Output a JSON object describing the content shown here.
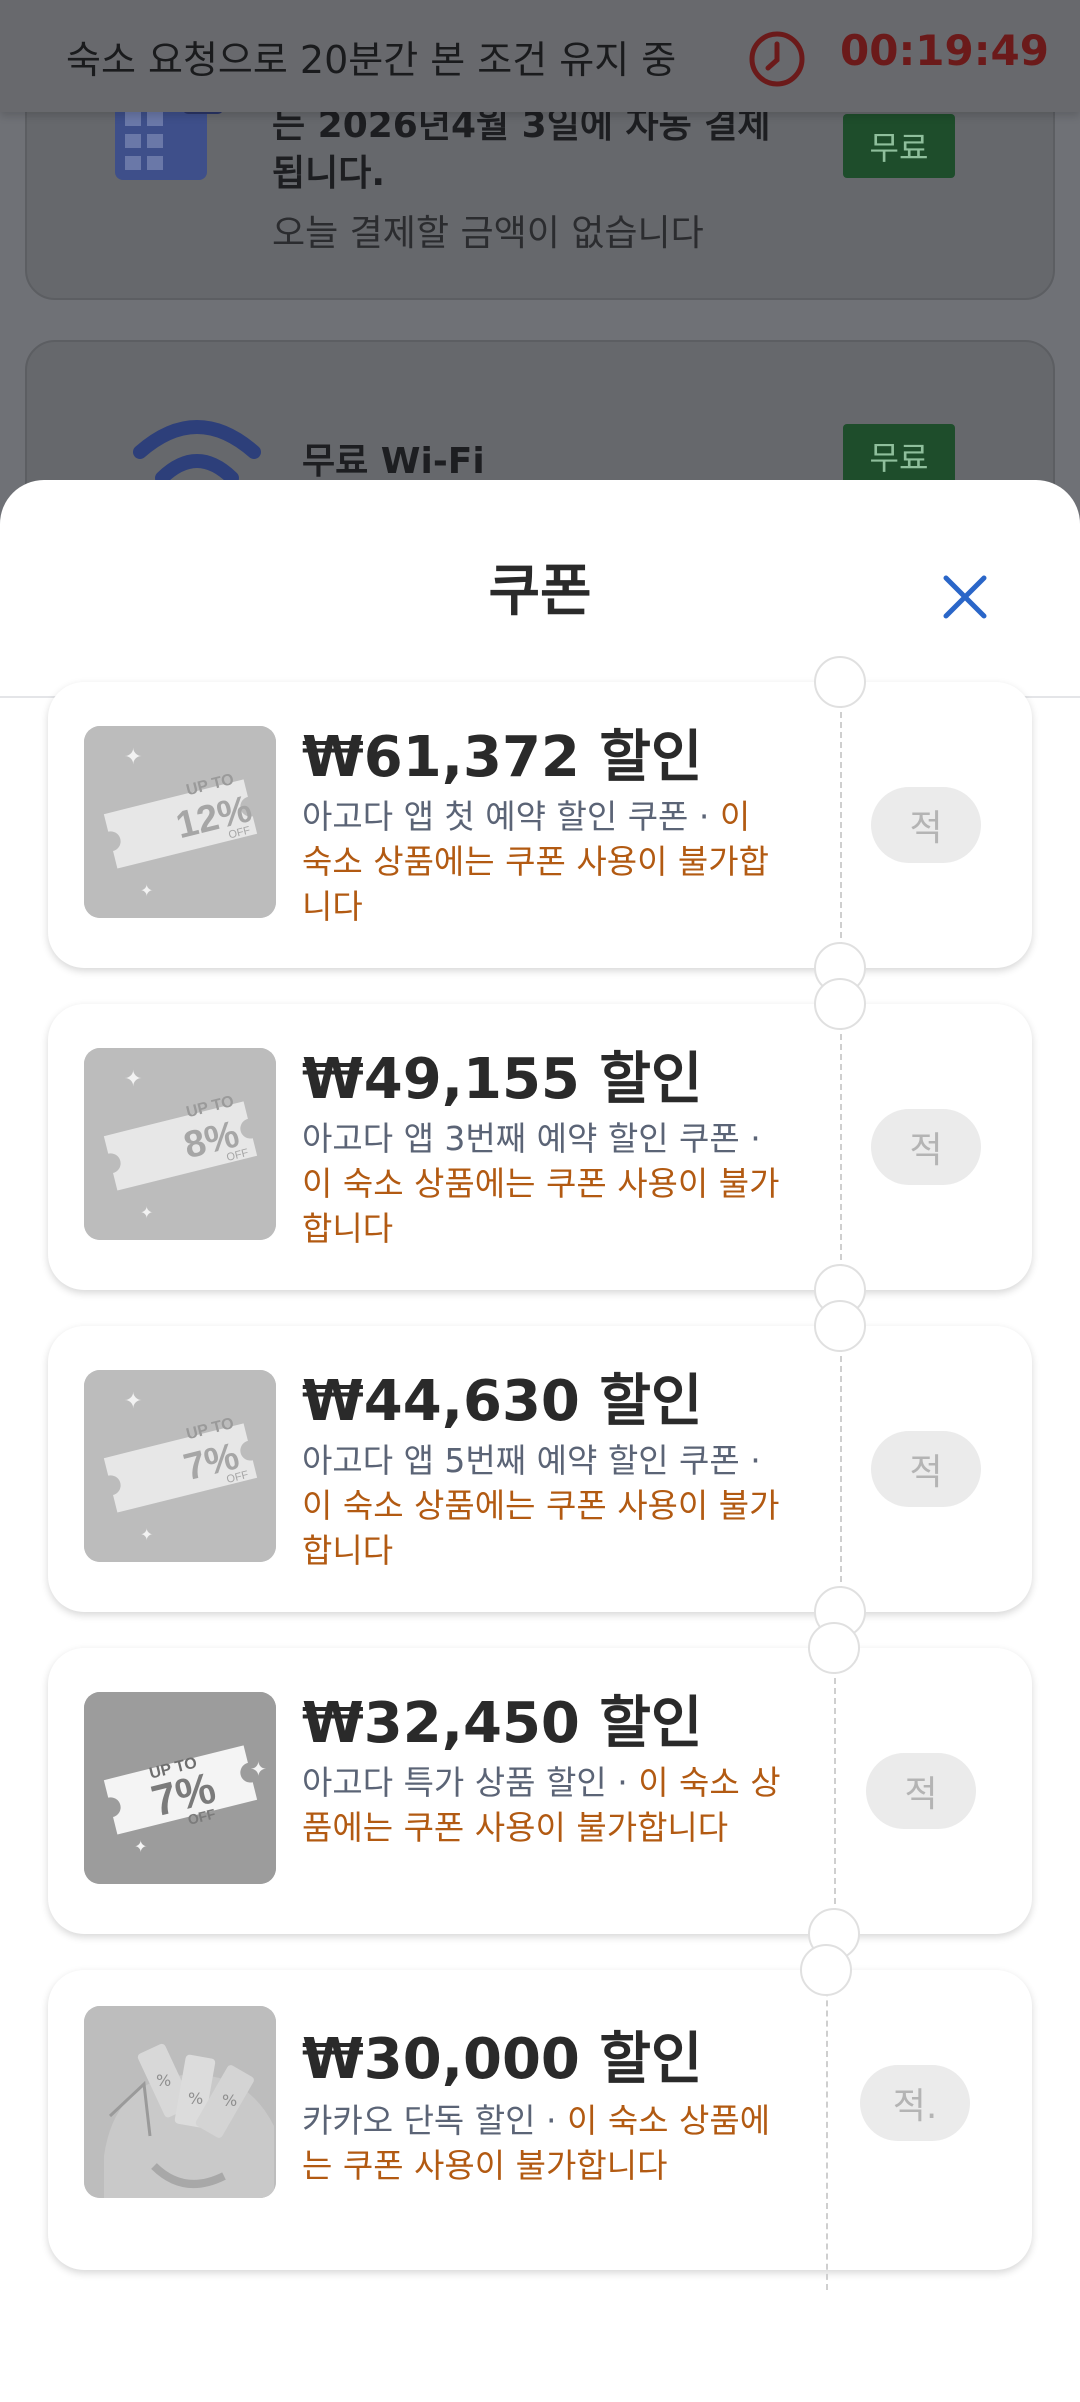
{
  "background": {
    "line1": "는 2026년4월 3일에 자동 결제",
    "line2": "됩니다.",
    "line3": "오늘 결제할 금액이 없습니다",
    "wifi_label": "무료 Wi-Fi",
    "free_badge": "무료"
  },
  "topbar": {
    "notice": "숙소 요청으로 20분간 본 조건 유지 중",
    "timer": "00:19:49"
  },
  "sheet": {
    "title": "쿠폰",
    "close_icon": "close-icon"
  },
  "coupons": [
    {
      "amount": "₩61,372 할인",
      "name": "아고다 앱 첫 예약 할인 쿠폰 · ",
      "warning": "이 숙소 상품에는 쿠폰 사용이 불가합니다",
      "badge_top": "UP TO",
      "badge_pct": "12%",
      "badge_off": "OFF",
      "apply": "적"
    },
    {
      "amount": "₩49,155 할인",
      "name": "아고다 앱 3번째 예약 할인 쿠폰 · ",
      "warning": "이 숙소 상품에는 쿠폰 사용이 불가합니다",
      "badge_top": "UP TO",
      "badge_pct": "8%",
      "badge_off": "OFF",
      "apply": "적"
    },
    {
      "amount": "₩44,630 할인",
      "name": "아고다 앱 5번째 예약 할인 쿠폰 · ",
      "warning": "이 숙소 상품에는 쿠폰 사용이 불가합니다",
      "badge_top": "UP TO",
      "badge_pct": "7%",
      "badge_off": "OFF",
      "apply": "적"
    },
    {
      "amount": "₩32,450 할인",
      "name": "아고다 특가 상품 할인 · ",
      "warning": "이 숙소 상품에는 쿠폰 사용이 불가합니다",
      "badge_top": "UP TO",
      "badge_pct": "7%",
      "badge_off": "OFF",
      "apply": "적"
    },
    {
      "amount": "₩30,000 할인",
      "name": "카카오 단독 할인 · ",
      "warning": "이 숙소 상품에는 쿠폰 사용이 불가합니다",
      "badge_top": "",
      "badge_pct": "",
      "badge_off": "",
      "apply": "적."
    }
  ]
}
